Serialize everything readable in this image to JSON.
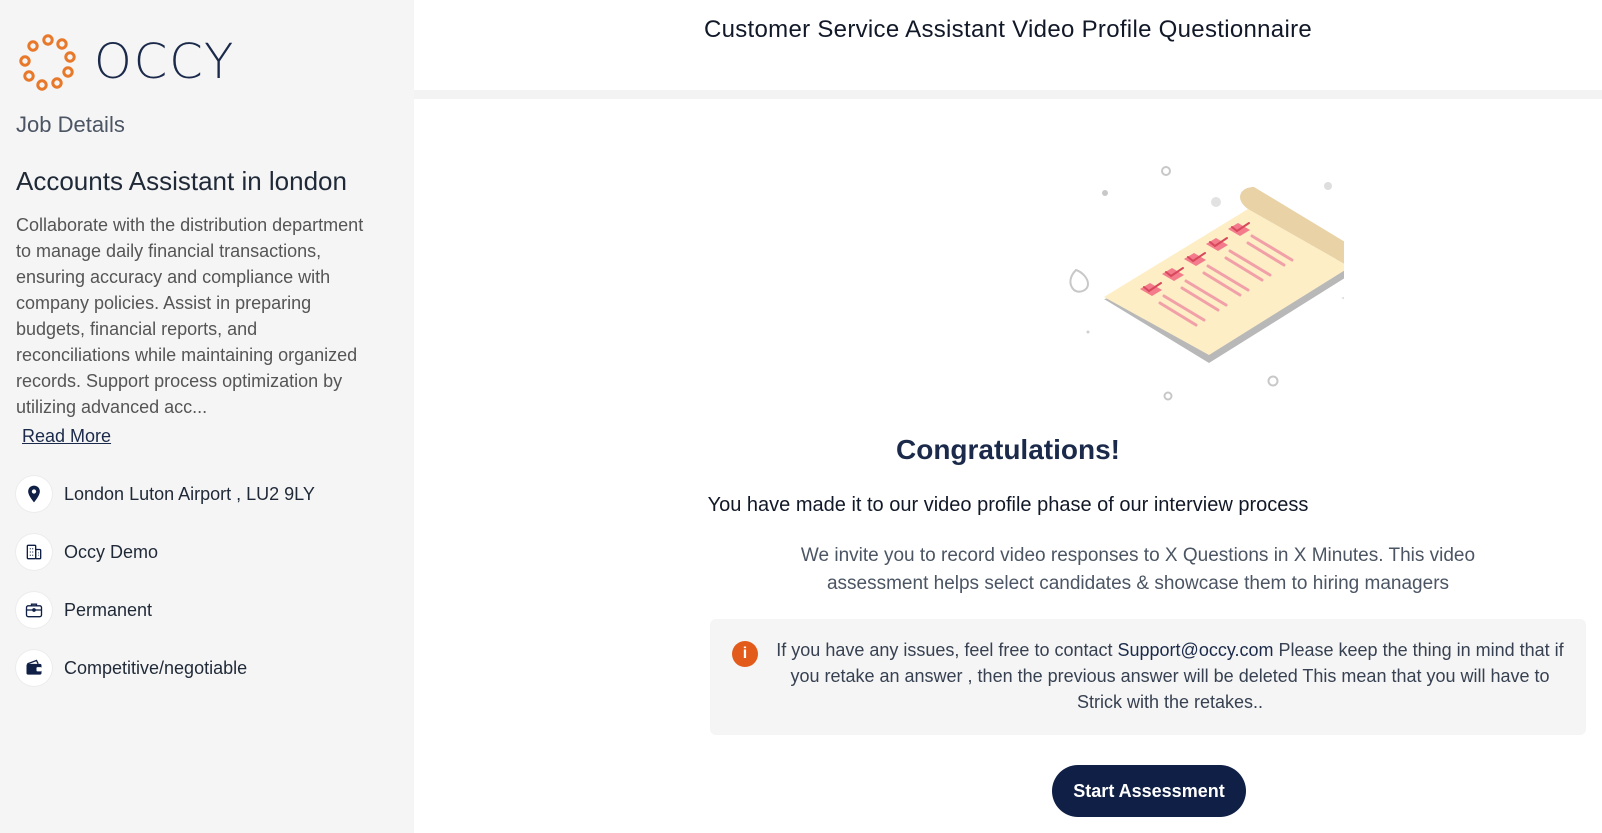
{
  "brand": {
    "name": "OCCY",
    "accent_color": "#e8792b",
    "navy_color": "#0f1f45"
  },
  "header": {
    "title": "Customer Service Assistant Video Profile Questionnaire"
  },
  "sidebar": {
    "section_label": "Job Details",
    "job_title": "Accounts Assistant in london",
    "job_description": "Collaborate with the distribution department to manage daily financial transactions, ensuring accuracy and compliance with company policies. Assist in preparing budgets, financial reports, and reconciliations while maintaining organized records. Support process optimization by utilizing advanced acc...",
    "read_more": "Read More",
    "meta": [
      {
        "icon": "location-pin-icon",
        "text": "London Luton Airport , LU2 9LY"
      },
      {
        "icon": "building-icon",
        "text": "Occy Demo"
      },
      {
        "icon": "briefcase-icon",
        "text": "Permanent"
      },
      {
        "icon": "wallet-icon",
        "text": "Competitive/negotiable"
      }
    ]
  },
  "main": {
    "illustration_icon": "checklist-document-icon",
    "heading": "Congratulations!",
    "subtitle": "You have made it to our video profile phase of our interview process",
    "description": "We invite you to record video responses to X Questions in X Minutes. This video assessment helps select candidates & showcase them to hiring managers",
    "info": {
      "icon": "info-icon",
      "before_link": "If you have any issues, feel free to contact ",
      "link": "Support@occy.com",
      "after_link": " Please keep the thing in mind that if you retake an answer , then the previous answer will be deleted This mean that you will have to Strick with the retakes.."
    },
    "start_button": "Start Assessment"
  }
}
